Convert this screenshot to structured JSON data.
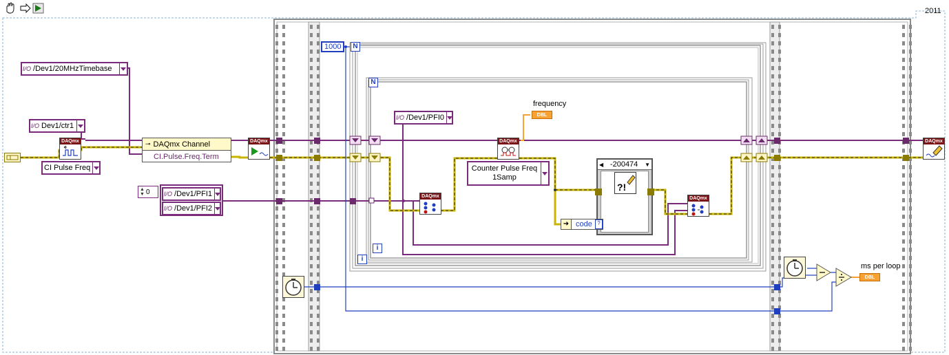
{
  "version": "2011",
  "constants": {
    "timebase": "/Dev1/20MHzTimebase",
    "counter": "Dev1/ctr1",
    "measurement": "CI Pulse Freq",
    "channel_property": "DAQmx Channel",
    "channel_property_item": "CI.Pulse.Freq.Term",
    "pfi0": "/Dev1/PFI0",
    "pfi1": "/Dev1/PFI1",
    "pfi2": "/Dev1/PFI2",
    "array_index": "0",
    "iterations": "1000",
    "read_mode_line1": "Counter Pulse Freq",
    "read_mode_line2": "1Samp",
    "error_case": "-200474",
    "code_label": "code"
  },
  "labels": {
    "frequency": "frequency",
    "ms_per_loop": "ms per loop",
    "dbl": "DBL",
    "loop_n": "N",
    "loop_i": "i",
    "daqmx": "DAQmx"
  },
  "colors": {
    "purple_wire": "#7a2a7a",
    "error_wire": "#c8b400",
    "numeric_wire": "#1f3fbf",
    "frame": "#9a9a9a"
  }
}
